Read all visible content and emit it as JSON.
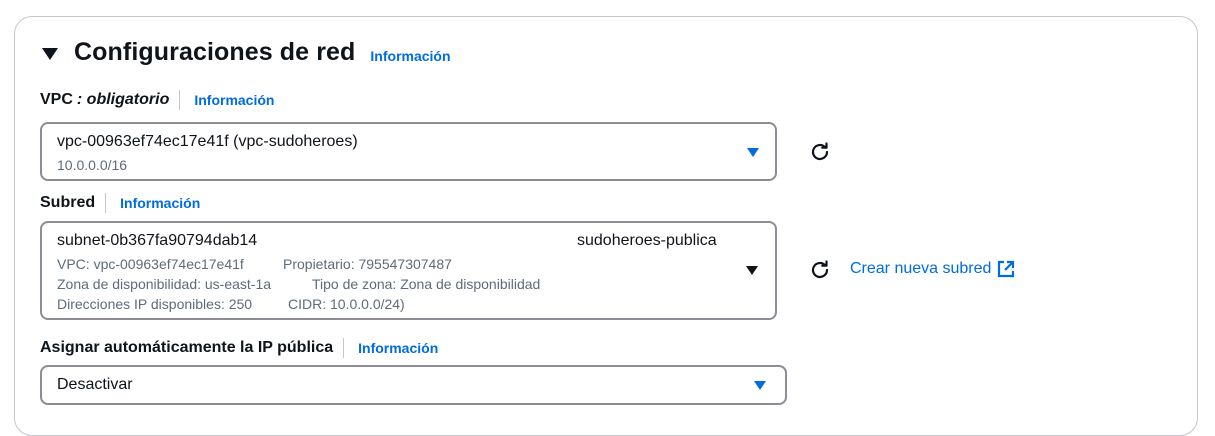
{
  "section": {
    "title": "Configuraciones de red",
    "info": "Información"
  },
  "vpc": {
    "label": "VPC",
    "required": ": obligatorio",
    "info": "Información",
    "value": "vpc-00963ef74ec17e41f (vpc-sudoheroes)",
    "cidr": "10.0.0.0/16"
  },
  "subnet": {
    "label": "Subred",
    "info": "Información",
    "id": "subnet-0b367fa90794dab14",
    "name": "sudoheroes-publica",
    "details_line1_a": "VPC: vpc-00963ef74ec17e41f",
    "details_line1_b": "Propietario: 795547307487",
    "details_line2_a": "Zona de disponibilidad: us-east-1a",
    "details_line2_b": "Tipo de zona: Zona de disponibilidad",
    "details_line3_a": "Direcciones IP disponibles: 250",
    "details_line3_b": "CIDR: 10.0.0.0/24)",
    "create_link": "Crear nueva subred"
  },
  "public_ip": {
    "label": "Asignar automáticamente la IP pública",
    "info": "Información",
    "value": "Desactivar"
  },
  "icons": {
    "collapse": "caret-down-icon",
    "refresh": "refresh-icon",
    "external": "external-link-icon",
    "dropdown": "dropdown-triangle-icon"
  },
  "colors": {
    "link": "#006ce0",
    "border": "#8c8c94",
    "muted_text": "#5f6b7a"
  }
}
